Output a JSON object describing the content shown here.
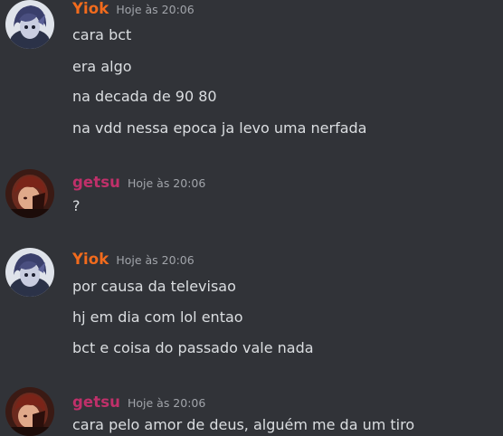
{
  "colors": {
    "background": "#313338",
    "text": "#dbdee1",
    "timestamp": "#a1a4aa",
    "yiok_name": "#f26b1d",
    "getsu_name": "#c0306a"
  },
  "messages": [
    {
      "author": "Yiok",
      "timestamp": "Hoje às 20:06",
      "avatar": "yiok-avatar",
      "lines": [
        "cara bct",
        "era algo",
        "na decada de 90 80",
        "na vdd nessa epoca ja levo uma nerfada"
      ]
    },
    {
      "author": "getsu",
      "timestamp": "Hoje às 20:06",
      "avatar": "getsu-avatar",
      "lines": [
        "?"
      ]
    },
    {
      "author": "Yiok",
      "timestamp": "Hoje às 20:06",
      "avatar": "yiok-avatar",
      "lines": [
        "por causa da televisao",
        "hj em dia com lol entao",
        "bct e coisa do passado vale nada"
      ]
    },
    {
      "author": "getsu",
      "timestamp": "Hoje às 20:06",
      "avatar": "getsu-avatar",
      "lines": [
        "cara pelo amor de deus, alguém me da um tiro"
      ]
    }
  ]
}
